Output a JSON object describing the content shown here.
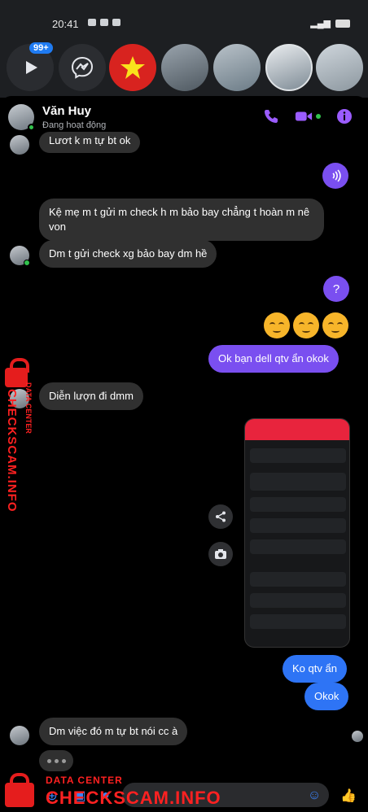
{
  "status_bar": {
    "time": "20:41"
  },
  "chat_heads": {
    "badge": "99+"
  },
  "header": {
    "name": "Văn Huy",
    "status": "Đang hoạt động"
  },
  "messages": {
    "m0": "Lươt k m tự bt ok",
    "m1": "Kệ mẹ m t gửi m  check h m bảo bay chẳng t hoàn m nê von",
    "m2": "Dm t gửi check xg bảo bay dm hề",
    "m3": "Ok bạn dell qtv ẩn okok",
    "m4": "Diễn lượn đi dmm",
    "m5": "Ko qtv ẩn",
    "m6": "Okok",
    "m7": "Dm việc đó m tự bt nói cc à"
  },
  "question_button": "?",
  "watermark": {
    "top_left": "DATA CENTER",
    "vertical": "CHECKSCAM.INFO",
    "bottom_label": "DATA CENTER",
    "bottom_brand": "CHECKSCAM.INFO"
  },
  "icons": [
    "play-icon",
    "messenger-icon",
    "star-icon",
    "phone-icon",
    "video-icon",
    "info-icon",
    "audio-icon",
    "share-icon",
    "camera-icon",
    "emoji-icon",
    "like-icon",
    "lock-icon"
  ],
  "colors": {
    "accent": "#7a4ff0",
    "sent_blue": "#2e74f5",
    "received": "#303030",
    "online": "#31c24d",
    "watermark": "#ff2121"
  }
}
